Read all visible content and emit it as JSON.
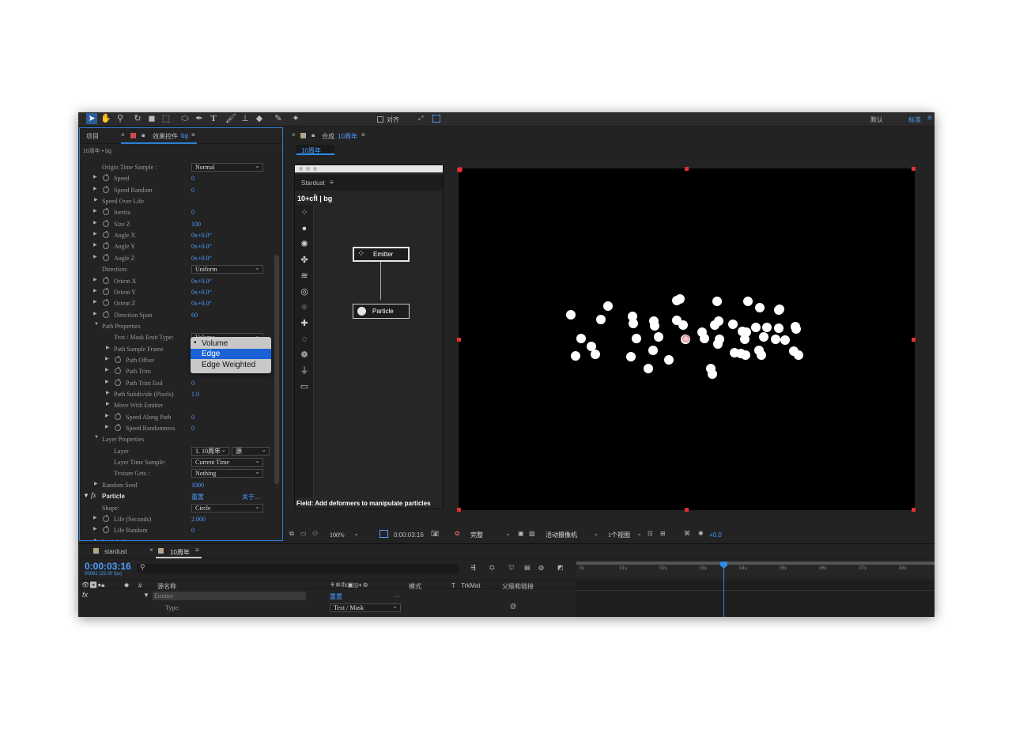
{
  "toolbar": {
    "align_label": "对齐",
    "workspace_default": "默认",
    "workspace_standard": "标准"
  },
  "project_panel": {
    "tab_project": "项目",
    "tab_effects": "效果控件",
    "tab_effects_layer": "bg",
    "breadcrumb": "10周年 • bg"
  },
  "properties": [
    {
      "label": "Origin Time Sample :",
      "dropdown": "Normal"
    },
    {
      "label": "Speed",
      "value": "0"
    },
    {
      "label": "Speed Random",
      "value": "0"
    },
    {
      "label": "Speed Over Life"
    },
    {
      "label": "Inertia",
      "value": "0"
    },
    {
      "label": "Size Z",
      "value": "100"
    },
    {
      "label": "Angle X",
      "value": "0x+0.0°"
    },
    {
      "label": "Angle Y",
      "value": "0x+0.0°"
    },
    {
      "label": "Angle Z",
      "value": "0x+0.0°"
    },
    {
      "label": "Direction:",
      "dropdown": "Uniform"
    },
    {
      "label": "Orient X",
      "value": "0x+0.0°"
    },
    {
      "label": "Orient Y",
      "value": "0x+0.0°"
    },
    {
      "label": "Orient Z",
      "value": "0x+0.0°"
    },
    {
      "label": "Direction Span",
      "value": "60"
    },
    {
      "label": "Path Properties"
    },
    {
      "label": "Text / Mask Emit Type:",
      "dropdown": "Volume"
    },
    {
      "label": "Path Sample Frame"
    },
    {
      "label": "Path Offset"
    },
    {
      "label": "Path Trim"
    },
    {
      "label": "Path Trim End",
      "value": "0"
    },
    {
      "label": "Path Subdivide (Pixels)",
      "value": "1.0"
    },
    {
      "label": "Move With Emitter"
    },
    {
      "label": "Speed Along Path",
      "value": "0"
    },
    {
      "label": "Speed Randomness",
      "value": "0"
    },
    {
      "label": "Layer Properties"
    },
    {
      "label": "Layer",
      "dropdown": "1. 10周年",
      "dropdown2": "源"
    },
    {
      "label": "Layer Time Sample:",
      "dropdown": "Current Time"
    },
    {
      "label": "Texture Gets :",
      "dropdown": "Nothing"
    },
    {
      "label": "Random Seed",
      "value": "1000"
    },
    {
      "label": "Particle",
      "value": "重置",
      "extra": "关于..."
    },
    {
      "label": "Shape:",
      "dropdown": "Circle"
    },
    {
      "label": "Life (Seconds)",
      "value": "2.000"
    },
    {
      "label": "Life Random",
      "value": "0"
    },
    {
      "label": "Particle Properties"
    }
  ],
  "emit_type_menu": {
    "options": [
      "Volume",
      "Edge",
      "Edge Weighted"
    ],
    "checked": "Volume",
    "highlighted": "Edge"
  },
  "comp_panel": {
    "tab_prefix": "合成",
    "comp_name": "10周年",
    "comp_tab": "10周年"
  },
  "stardust": {
    "panel_title": "Stardust",
    "path": "10+cf̃l | bg",
    "node_emitter": "Emitter",
    "node_particle": "Particle",
    "hint": "Field: Add deformers to manipulate particles"
  },
  "viewer_controls": {
    "zoom": "100%",
    "timecode": "0:00:03:16",
    "resolution": "完整",
    "camera": "活动摄像机",
    "views": "1个视图",
    "exposure": "+0.0"
  },
  "timeline": {
    "tab_stardust": "stardust",
    "tab_comp": "10周年",
    "timecode": "0:00:03:16",
    "frame_info": "00091 (25.00 fps)",
    "col_source": "源名称",
    "col_mode": "模式",
    "col_t": "T",
    "col_trkmat": "TrkMat",
    "col_parent": "父级和链接",
    "layer_name": "Emitter",
    "reset_label": "重置",
    "dots_label": "...",
    "type_label": "Type:",
    "type_value": "Text / Mask",
    "ruler": [
      "0s",
      "01s",
      "02s",
      "03s",
      "04s",
      "05s",
      "06s",
      "07s",
      "08s"
    ]
  },
  "colors": {
    "accent": "#2d8ceb",
    "panel_bg": "#232323",
    "viewer_bg": "#000000",
    "handle": "#e03030",
    "menu_highlight": "#1a62d6"
  }
}
